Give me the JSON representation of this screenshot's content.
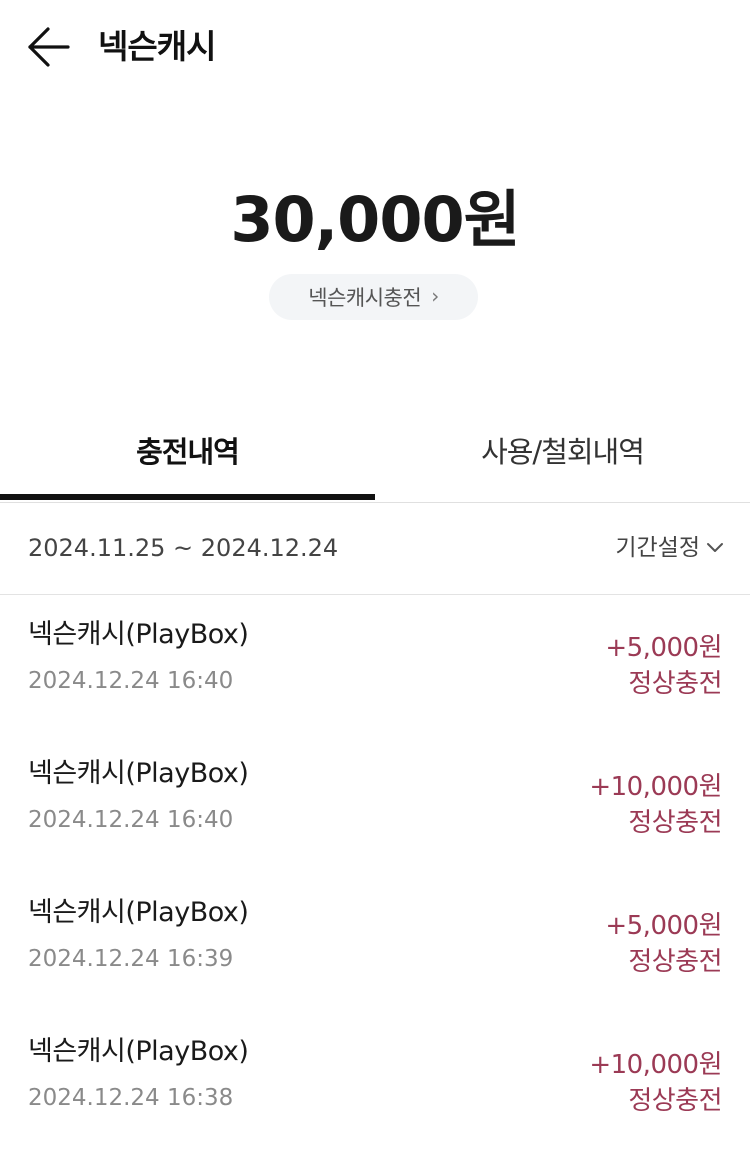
{
  "header": {
    "title": "넥슨캐시",
    "back_icon": "back-arrow-icon"
  },
  "balance": {
    "amount": "30,000원"
  },
  "charge_button": {
    "label": "넥슨캐시충전",
    "chevron": "›"
  },
  "tabs": [
    {
      "label": "충전내역",
      "active": true
    },
    {
      "label": "사용/철회내역",
      "active": false
    }
  ],
  "filter": {
    "date_range": "2024.11.25 ~ 2024.12.24",
    "period_label": "기간설정",
    "period_icon": "chevron-down-icon"
  },
  "transactions": [
    {
      "title": "넥슨캐시(PlayBox)",
      "datetime": "2024.12.24 16:40",
      "amount": "+5,000원",
      "status": "정상충전"
    },
    {
      "title": "넥슨캐시(PlayBox)",
      "datetime": "2024.12.24 16:40",
      "amount": "+10,000원",
      "status": "정상충전"
    },
    {
      "title": "넥슨캐시(PlayBox)",
      "datetime": "2024.12.24 16:39",
      "amount": "+5,000원",
      "status": "정상충전"
    },
    {
      "title": "넥슨캐시(PlayBox)",
      "datetime": "2024.12.24 16:38",
      "amount": "+10,000원",
      "status": "정상충전"
    }
  ],
  "colors": {
    "accent": "#9b3a55",
    "tab_indicator": "#111111"
  }
}
